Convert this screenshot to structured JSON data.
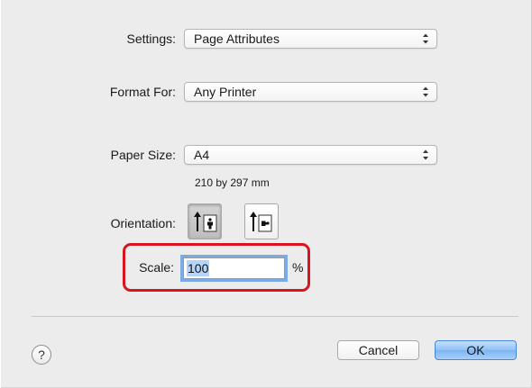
{
  "settings": {
    "label": "Settings:",
    "value": "Page Attributes"
  },
  "format_for": {
    "label": "Format For:",
    "value": "Any Printer"
  },
  "paper_size": {
    "label": "Paper Size:",
    "value": "A4",
    "dimensions": "210 by 297 mm"
  },
  "orientation": {
    "label": "Orientation:",
    "options": [
      "portrait",
      "landscape"
    ],
    "selected": "portrait"
  },
  "scale": {
    "label": "Scale:",
    "value": "100",
    "unit": "%"
  },
  "footer": {
    "help_label": "?",
    "cancel_label": "Cancel",
    "ok_label": "OK"
  },
  "colors": {
    "highlight": "#d8141e",
    "focus_ring": "#7aabe6",
    "default_button": "#8fc1f6"
  }
}
